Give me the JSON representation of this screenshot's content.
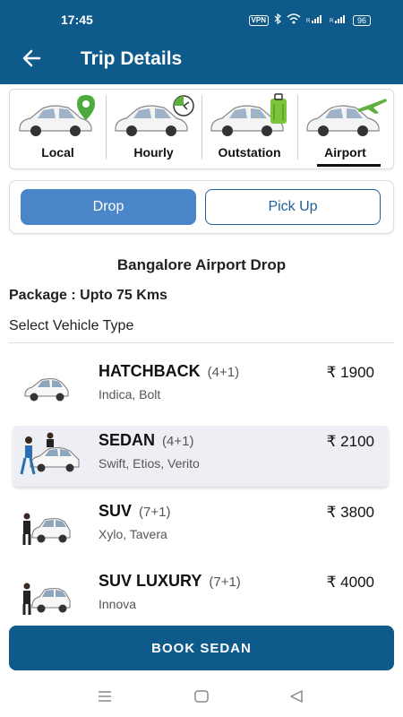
{
  "status_bar": {
    "time": "17:45",
    "vpn": "VPN",
    "battery": "96"
  },
  "app_bar": {
    "title": "Trip Details"
  },
  "trip_types": [
    {
      "label": "Local",
      "icon": "location-pin-icon"
    },
    {
      "label": "Hourly",
      "icon": "clock-icon"
    },
    {
      "label": "Outstation",
      "icon": "luggage-icon"
    },
    {
      "label": "Airport",
      "icon": "airplane-icon",
      "active": true
    }
  ],
  "modes": {
    "drop": "Drop",
    "pickup": "Pick Up",
    "selected": "drop"
  },
  "route_title": "Bangalore Airport Drop",
  "package": "Package : Upto 75 Kms",
  "select_label": "Select Vehicle Type",
  "vehicles": [
    {
      "name": "HATCHBACK",
      "capacity": "(4+1)",
      "models": "Indica, Bolt",
      "price": "₹ 1900"
    },
    {
      "name": "SEDAN",
      "capacity": "(4+1)",
      "models": "Swift, Etios, Verito",
      "price": "₹ 2100",
      "selected": true
    },
    {
      "name": "SUV",
      "capacity": "(7+1)",
      "models": "Xylo, Tavera",
      "price": "₹ 3800"
    },
    {
      "name": "SUV LUXURY",
      "capacity": "(7+1)",
      "models": "Innova",
      "price": "₹ 4000"
    }
  ],
  "book_button": "BOOK SEDAN",
  "colors": {
    "primary": "#0e5a8a",
    "accent": "#4a86c8",
    "selected_row": "#eeeff4"
  }
}
